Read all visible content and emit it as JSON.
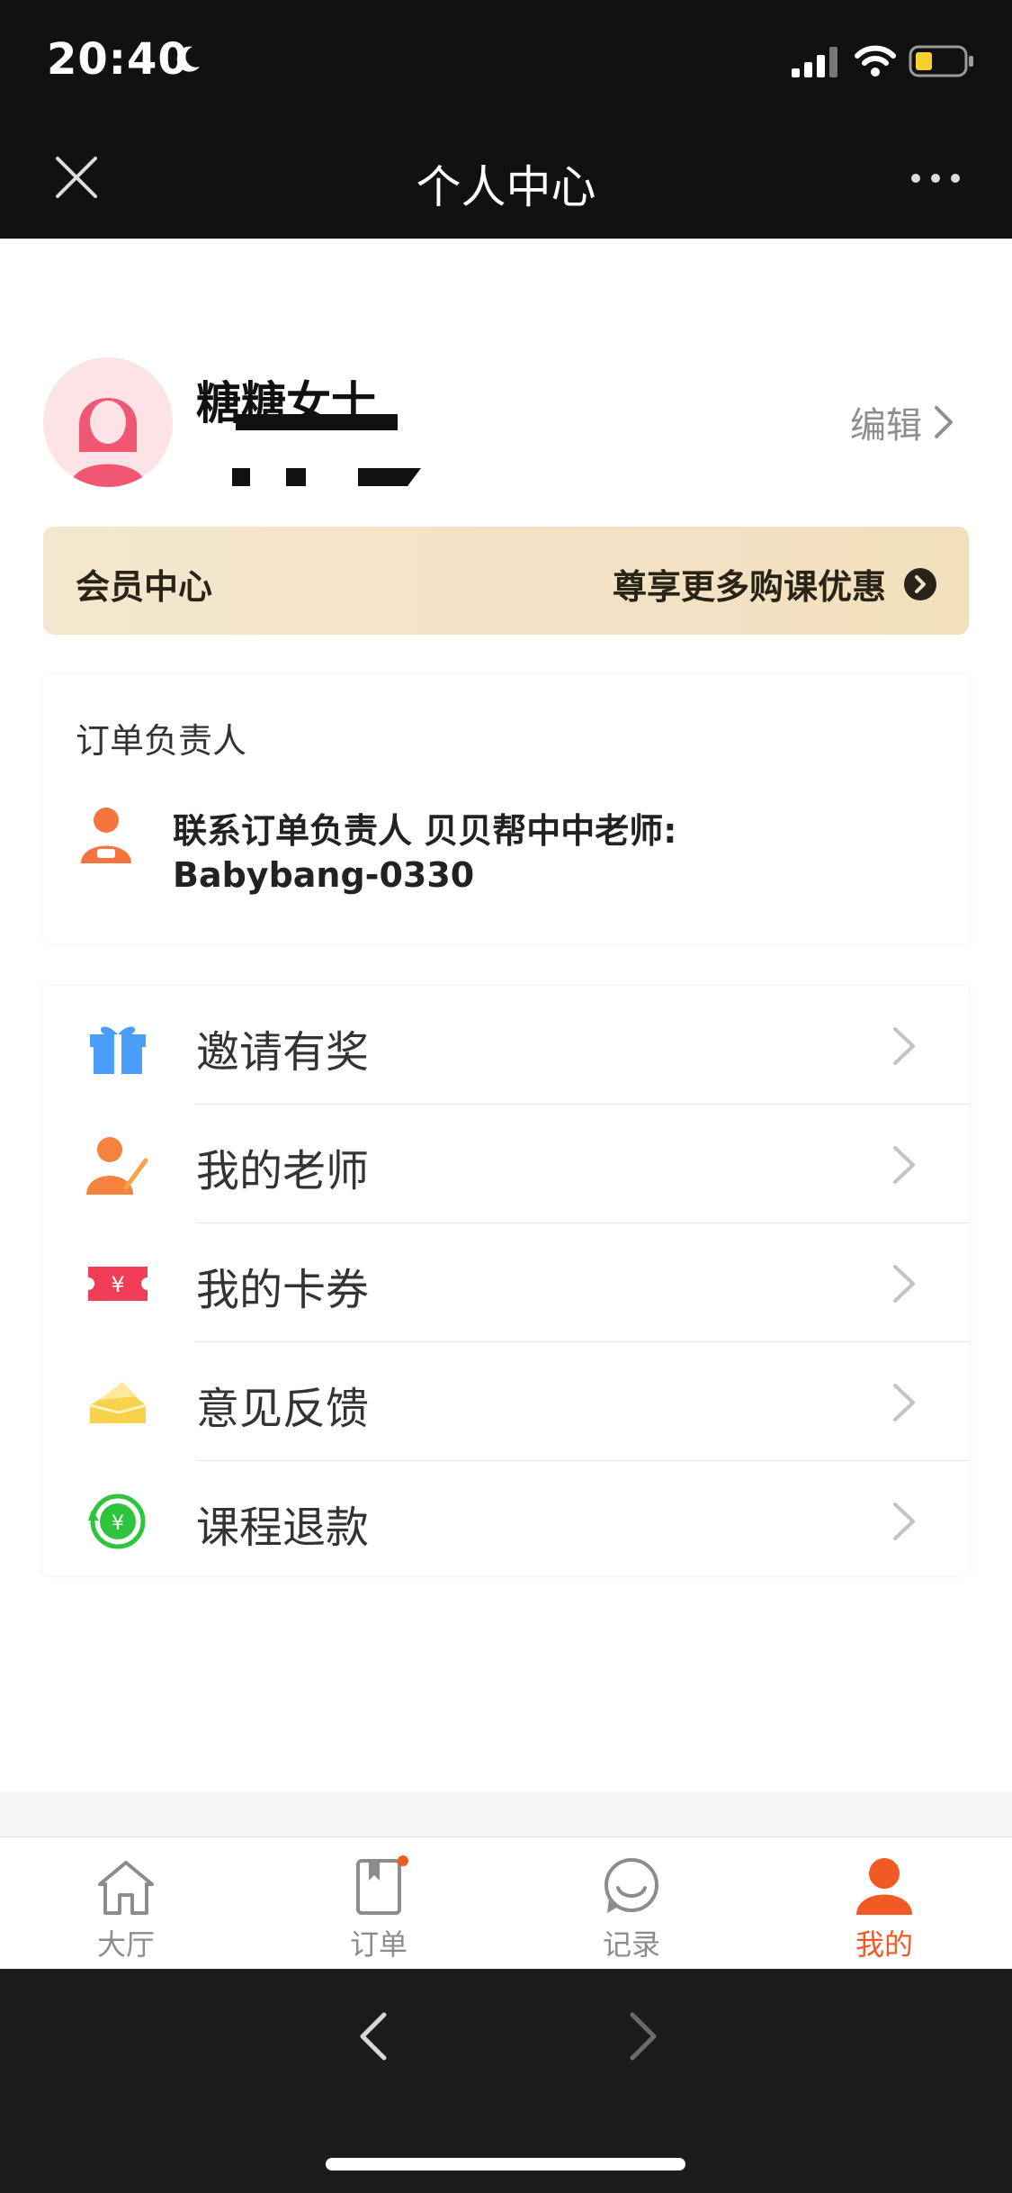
{
  "status_bar": {
    "time": "20:40",
    "icons": [
      "moon-icon",
      "signal-icon",
      "wifi-icon",
      "battery-icon"
    ]
  },
  "nav": {
    "title": "个人中心",
    "close_icon": "close-icon",
    "more_icon": "more-icon"
  },
  "profile": {
    "name": "糖糖女士",
    "edit_label": "编辑"
  },
  "member": {
    "title": "会员中心",
    "promo": "尊享更多购课优惠"
  },
  "owner": {
    "title": "订单负责人",
    "line1": "联系订单负责人 贝贝帮中中老师:",
    "line2": "Babybang-0330"
  },
  "menu": {
    "items": [
      {
        "label": "邀请有奖",
        "icon": "gift-icon"
      },
      {
        "label": "我的老师",
        "icon": "teacher-icon"
      },
      {
        "label": "我的卡券",
        "icon": "coupon-icon"
      },
      {
        "label": "意见反馈",
        "icon": "feedback-icon"
      },
      {
        "label": "课程退款",
        "icon": "refund-icon"
      }
    ]
  },
  "tabs": [
    {
      "label": "大厅",
      "icon": "home-icon",
      "active": false
    },
    {
      "label": "订单",
      "icon": "order-icon",
      "active": false,
      "badge": true
    },
    {
      "label": "记录",
      "icon": "record-icon",
      "active": false
    },
    {
      "label": "我的",
      "icon": "profile-icon",
      "active": true
    }
  ],
  "colors": {
    "accent": "#f15a24",
    "member_bg": "#f3e3c6",
    "nav_bg": "#111111"
  }
}
